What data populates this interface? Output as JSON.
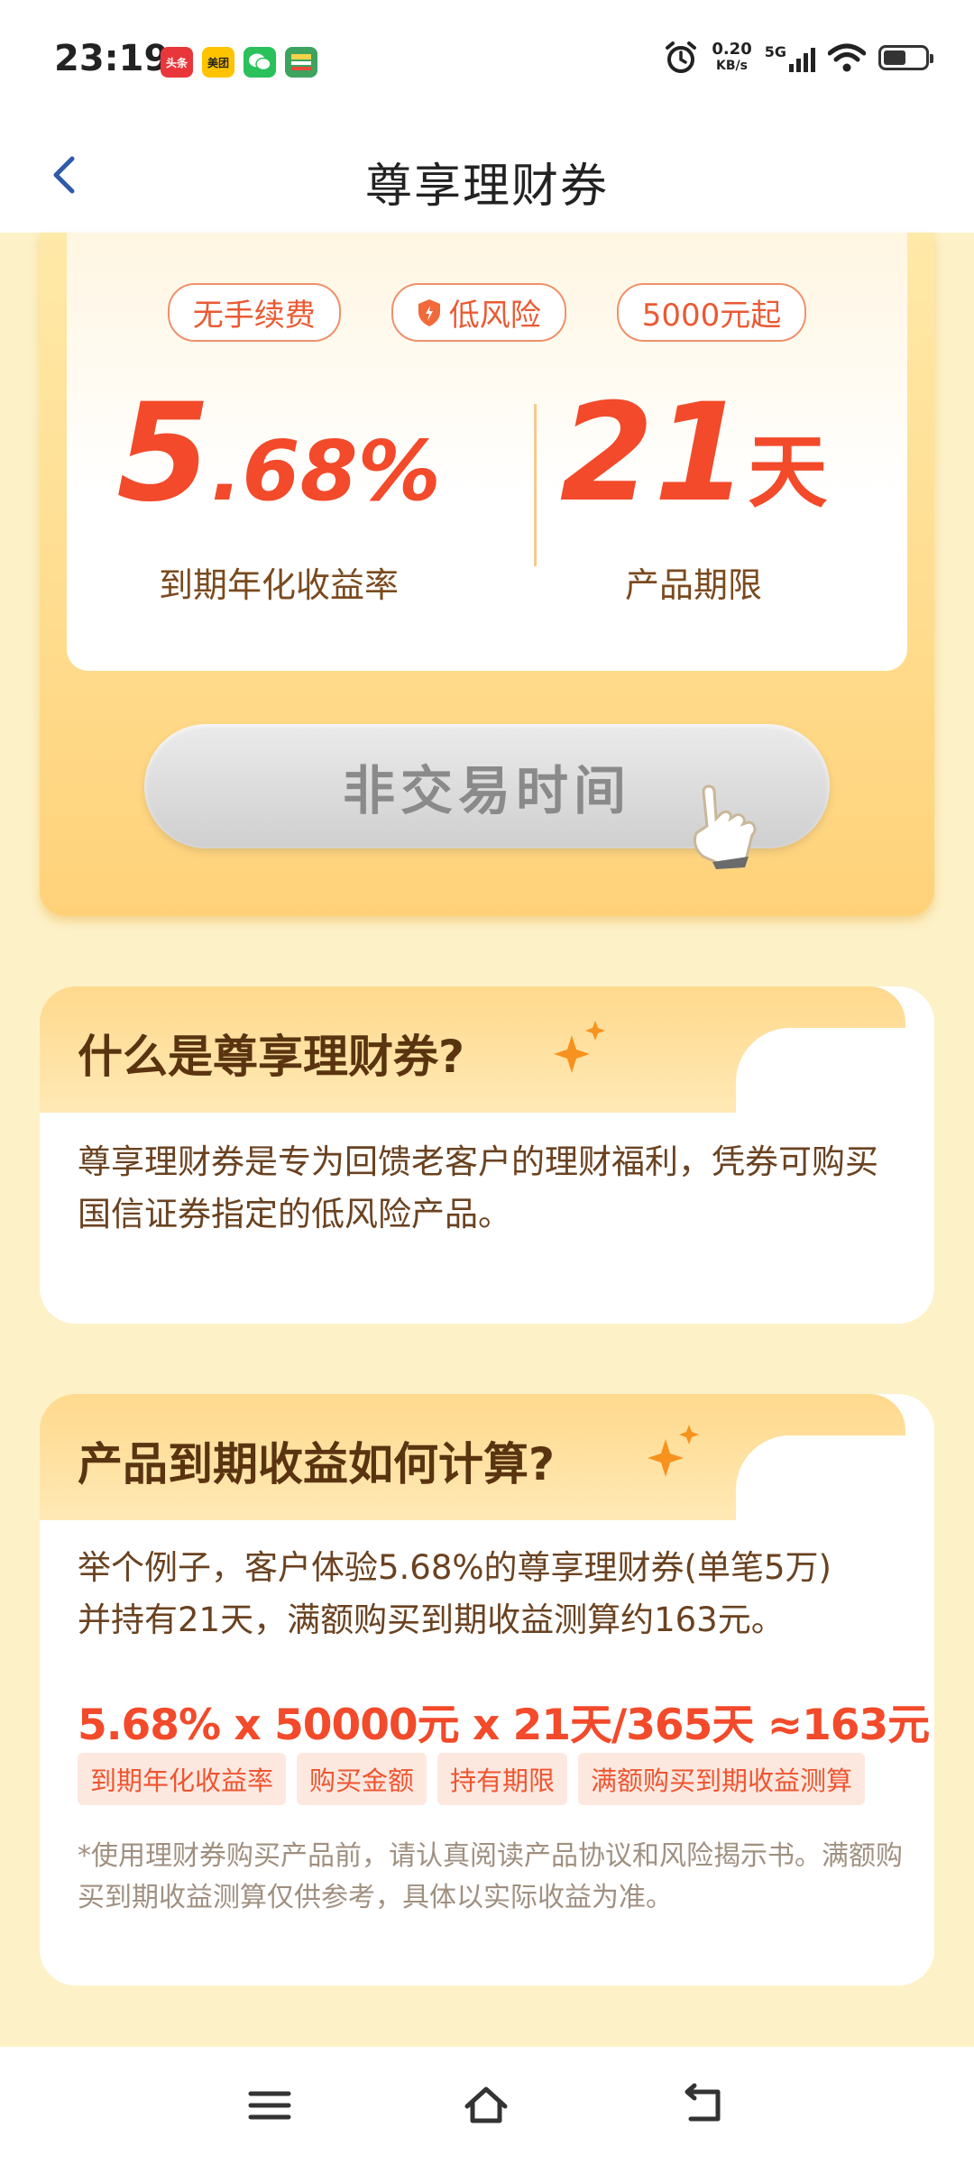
{
  "status_bar": {
    "time": "23:19",
    "app_icons": [
      {
        "name": "toutiao",
        "label": "头条",
        "color": "#e9363a"
      },
      {
        "name": "meituan",
        "label": "美团",
        "color": "#ffc300"
      },
      {
        "name": "wechat",
        "label": "",
        "color": "#2ac15b"
      },
      {
        "name": "guosen",
        "label": "",
        "color": "#3da35f"
      }
    ],
    "netspeed_value": "0.20",
    "netspeed_unit": "KB/s",
    "network": "5G"
  },
  "navbar": {
    "title": "尊享理财券"
  },
  "hero": {
    "tags": [
      "无手续费",
      "低风险",
      "5000元起"
    ],
    "rate_number": "5",
    "rate_decimal": ".68%",
    "rate_label": "到期年化收益率",
    "term_number": "21",
    "term_unit": "天",
    "term_label": "产品期限",
    "trade_button": "非交易时间"
  },
  "card1": {
    "title": "什么是尊享理财券?",
    "text": "尊享理财券是专为回馈老客户的理财福利，凭券可购买国信证券指定的低风险产品。"
  },
  "card2": {
    "title": "产品到期收益如何计算?",
    "example_line1": "举个例子，客户体验5.68%的尊享理财券(单笔5万)",
    "example_line2": "并持有21天，满额购买到期收益测算约163元。",
    "formula": "5.68% x 50000元 x 21天/365天 ≈163元",
    "formula_labels": [
      "到期年化收益率",
      "购买金额",
      "持有期限",
      "满额购买到期收益测算"
    ],
    "note": "*使用理财券购买产品前，请认真阅读产品协议和风险揭示书。满额购买到期收益测算仅供参考，具体以实际收益为准。"
  },
  "colors": {
    "accent": "#f24a2a",
    "background": "#fdf1c7",
    "card_head": "#ffd98d"
  }
}
